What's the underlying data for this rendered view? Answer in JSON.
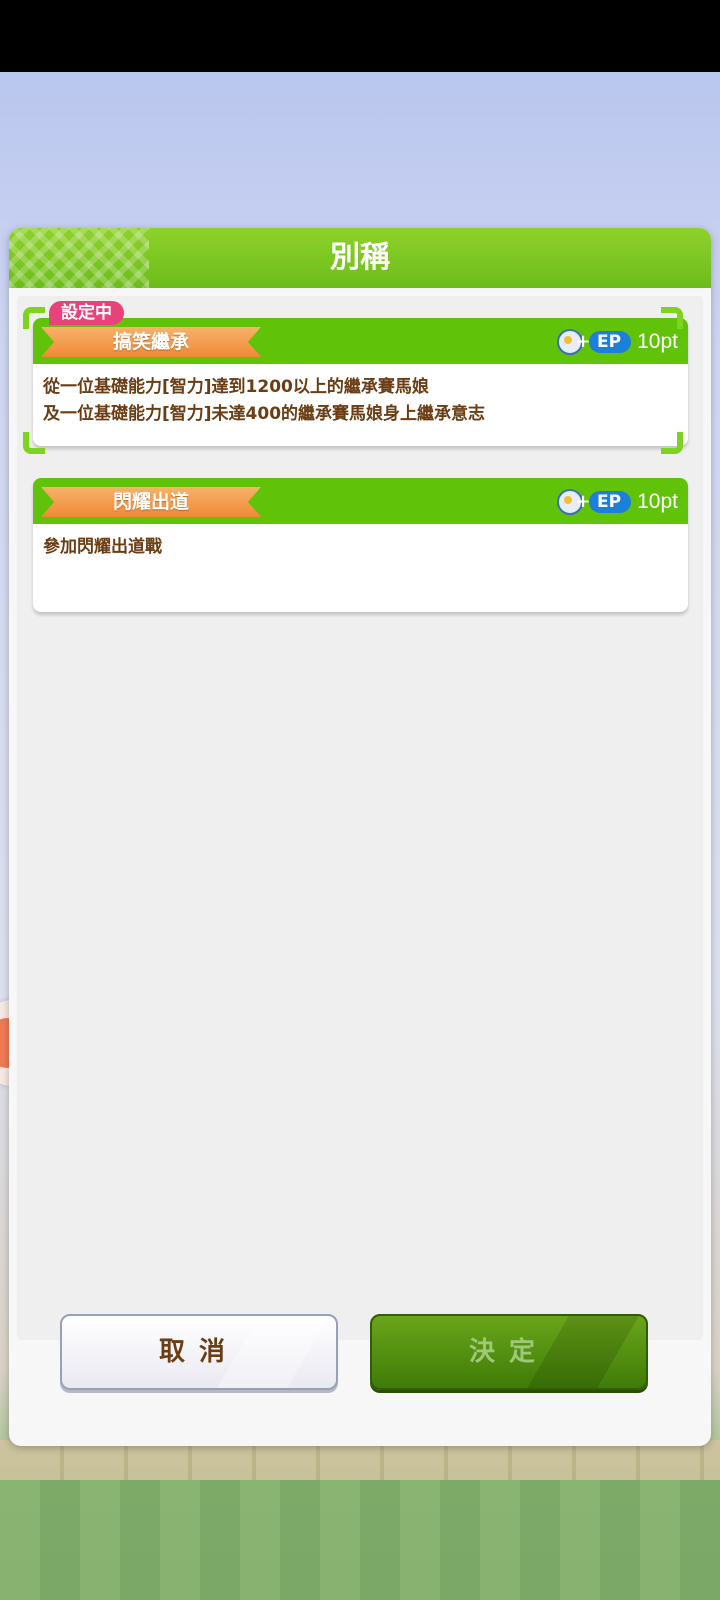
{
  "dialog": {
    "title": "別稱",
    "setting_badge": "設定中",
    "cards": [
      {
        "name": "搞笑繼承",
        "ep_label": "EP",
        "points": "10pt",
        "description": "從一位基礎能力[智力]達到1200以上的繼承賽馬娘\n及一位基礎能力[智力]未達400的繼承賽馬娘身上繼承意志",
        "selected": true
      },
      {
        "name": "閃耀出道",
        "ep_label": "EP",
        "points": "10pt",
        "description": "參加閃耀出道戰",
        "selected": false
      }
    ],
    "buttons": {
      "cancel": "取消",
      "confirm": "決定"
    }
  },
  "colors": {
    "header_green": "#6cbd1a",
    "card_head_green": "#61c20a",
    "ribbon_orange": "#f08a35",
    "badge_pink": "#e8427a",
    "text_brown": "#6b3d14"
  }
}
